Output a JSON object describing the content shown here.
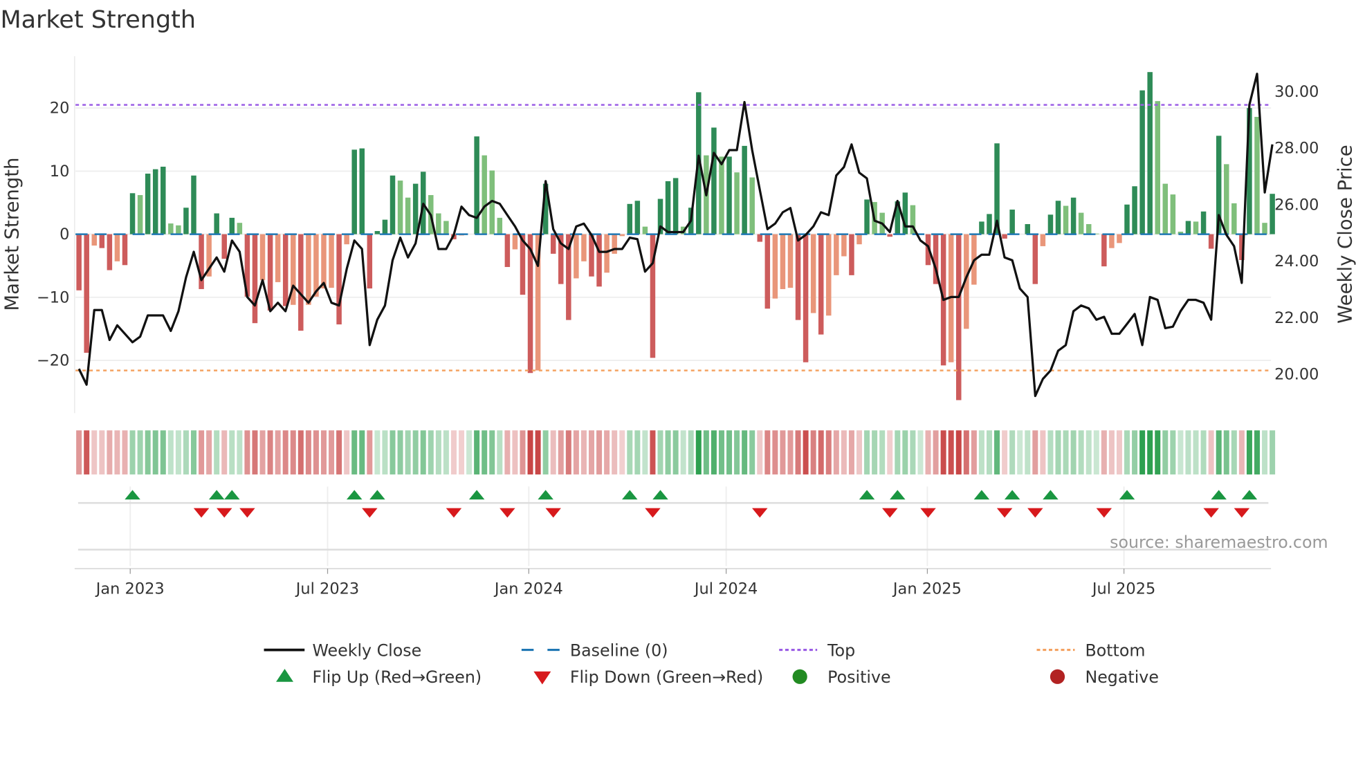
{
  "chart_data": {
    "type": "bar",
    "title": "Market Strength",
    "ylabel": "Market Strength",
    "y2label": "Weekly Close Price",
    "ylim": [
      -28,
      28.5
    ],
    "y2lim": [
      19.0,
      31.2
    ],
    "yticks": [
      {
        "v": 20,
        "label": "20"
      },
      {
        "v": 10,
        "label": "10"
      },
      {
        "v": 0,
        "label": "0"
      },
      {
        "v": -10,
        "label": "−10"
      },
      {
        "v": -20,
        "label": "−20"
      }
    ],
    "y2ticks": [
      {
        "v": 30,
        "label": "30.00"
      },
      {
        "v": 28,
        "label": "28.00"
      },
      {
        "v": 26,
        "label": "26.00"
      },
      {
        "v": 24,
        "label": "24.00"
      },
      {
        "v": 22,
        "label": "22.00"
      },
      {
        "v": 20,
        "label": "20.00"
      }
    ],
    "xticks": [
      {
        "week": 6.7,
        "label": "Jan 2023"
      },
      {
        "week": 32.5,
        "label": "Jul 2023"
      },
      {
        "week": 58.8,
        "label": "Jan 2024"
      },
      {
        "week": 84.6,
        "label": "Jul 2024"
      },
      {
        "week": 110.9,
        "label": "Jan 2025"
      },
      {
        "week": 136.6,
        "label": "Jul 2025"
      }
    ],
    "top": 20.5,
    "bottom": -21.6,
    "baseline": 0,
    "strength": [
      -8.9,
      -18.8,
      -1.8,
      -2.2,
      -5.7,
      -4.3,
      -4.9,
      6.5,
      6.2,
      9.6,
      10.3,
      10.7,
      1.7,
      1.4,
      4.2,
      9.3,
      -8.7,
      -6.7,
      3.3,
      -3.9,
      2.6,
      1.8,
      -9.9,
      -14.1,
      -7.3,
      -12.1,
      -7.6,
      -11.4,
      -11.2,
      -15.3,
      -11.2,
      -9.9,
      -8.6,
      -8.5,
      -14.3,
      -1.6,
      13.4,
      13.6,
      -8.6,
      0.5,
      2.3,
      9.3,
      8.5,
      5.8,
      8.0,
      9.9,
      6.2,
      3.3,
      2.1,
      -0.8,
      -0.2,
      0,
      15.5,
      12.5,
      10.1,
      2.6,
      -5.2,
      -2.4,
      -9.6,
      -22.0,
      -21.6,
      8.0,
      -3.1,
      -7.9,
      -13.6,
      -7.0,
      -4.3,
      -6.7,
      -8.3,
      -6.1,
      -3.1,
      -0.3,
      4.8,
      5.3,
      1.2,
      -19.6,
      5.6,
      8.4,
      8.9,
      1.2,
      4.2,
      22.5,
      12.5,
      16.9,
      12.3,
      12.3,
      9.8,
      14.0,
      9.0,
      -1.2,
      -11.8,
      -10.2,
      -8.7,
      -8.5,
      -13.6,
      -20.3,
      -12.5,
      -15.9,
      -12.9,
      -6.5,
      -3.5,
      -6.5,
      -1.6,
      5.5,
      5.1,
      3.4,
      -0.4,
      5.2,
      6.6,
      4.6,
      0,
      -4.9,
      -7.9,
      -20.8,
      -20.3,
      -26.3,
      -15.0,
      -8.0,
      2.0,
      3.2,
      14.4,
      -0.7,
      3.9,
      0,
      1.6,
      -7.9,
      -1.9,
      3.1,
      5.3,
      4.5,
      5.8,
      3.4,
      1.6,
      0.1,
      -5.1,
      -2.2,
      -1.4,
      4.7,
      7.6,
      22.8,
      25.7,
      21.1,
      8.0,
      6.3,
      0.4,
      2.1,
      2.0,
      3.6,
      -2.3,
      15.6,
      11.1,
      4.9,
      -4.1,
      20.0,
      18.6,
      1.8,
      6.4
    ],
    "close": [
      20.16,
      19.6,
      22.24,
      22.24,
      21.18,
      21.7,
      21.4,
      21.1,
      21.3,
      22.05,
      22.05,
      22.05,
      21.5,
      22.2,
      23.4,
      24.3,
      23.3,
      23.7,
      24.1,
      23.6,
      24.7,
      24.3,
      22.7,
      22.4,
      23.3,
      22.2,
      22.5,
      22.2,
      23.1,
      22.8,
      22.5,
      22.9,
      23.2,
      22.5,
      22.4,
      23.7,
      24.7,
      24.4,
      21.0,
      21.9,
      22.4,
      24.0,
      24.8,
      24.1,
      24.6,
      26.0,
      25.6,
      24.4,
      24.4,
      24.9,
      25.9,
      25.6,
      25.5,
      25.9,
      26.1,
      26.0,
      25.6,
      25.2,
      24.7,
      24.4,
      23.8,
      26.8,
      25.1,
      24.6,
      24.4,
      25.2,
      25.3,
      24.9,
      24.3,
      24.3,
      24.4,
      24.4,
      24.8,
      24.75,
      23.6,
      23.9,
      25.2,
      25.0,
      25.0,
      25.0,
      25.4,
      27.7,
      26.3,
      27.8,
      27.4,
      27.9,
      27.9,
      29.6,
      27.9,
      26.5,
      25.1,
      25.3,
      25.7,
      25.85,
      24.7,
      24.9,
      25.2,
      25.7,
      25.6,
      27.0,
      27.3,
      28.1,
      27.1,
      26.9,
      25.4,
      25.3,
      25.0,
      26.1,
      25.2,
      25.2,
      24.7,
      24.5,
      23.7,
      22.6,
      22.7,
      22.7,
      23.4,
      24.0,
      24.2,
      24.2,
      25.4,
      24.1,
      24.0,
      23.0,
      22.7,
      19.2,
      19.8,
      20.1,
      20.8,
      21.0,
      22.2,
      22.4,
      22.3,
      21.9,
      22.0,
      21.4,
      21.4,
      21.75,
      22.1,
      21.0,
      22.7,
      22.6,
      21.6,
      21.65,
      22.2,
      22.6,
      22.6,
      22.5,
      21.9,
      25.6,
      24.9,
      24.5,
      23.2,
      29.5,
      30.6,
      26.4,
      28.1
    ],
    "colors": {
      "pos_strong": "#2e8b57",
      "pos_weak": "#7fbf7b",
      "neg_strong": "#cd5c5c",
      "neg_weak": "#e9967a",
      "baseline": "#1f77b4",
      "top": "#9b5de5",
      "bottom": "#f4a261",
      "flip_up": "#1a9641",
      "flip_down": "#d7191c",
      "close": "#111111"
    },
    "legend": [
      {
        "key": "close",
        "label": "Weekly Close"
      },
      {
        "key": "baseline",
        "label": "Baseline (0)"
      },
      {
        "key": "top",
        "label": "Top"
      },
      {
        "key": "bottom",
        "label": "Bottom"
      },
      {
        "key": "flip_up",
        "label": "Flip Up (Red→Green)"
      },
      {
        "key": "flip_down",
        "label": "Flip Down (Green→Red)"
      },
      {
        "key": "positive",
        "label": "Positive"
      },
      {
        "key": "negative",
        "label": "Negative"
      }
    ],
    "legend_position": "bottom",
    "source": "source: sharemaestro.com"
  }
}
